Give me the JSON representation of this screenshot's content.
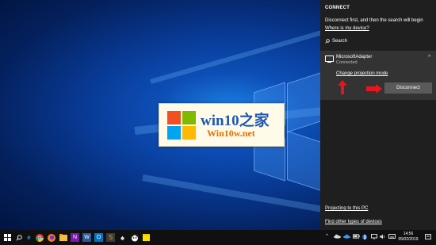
{
  "watermark": {
    "text_main": "win10之家",
    "text_url": "Win10w.net"
  },
  "connect_panel": {
    "title": "CONNECT",
    "description": "Disconnect first, and then the search will begin",
    "where_link": "Where is my device?",
    "search_label": "Search",
    "device": {
      "name": "MicrosoftAdapter",
      "status": "Connected",
      "change_mode_link": "Change projection mode",
      "disconnect_label": "Disconnect"
    },
    "projecting_link": "Projecting to this PC",
    "other_devices_link": "Find other types of devices"
  },
  "taskbar": {
    "time": "14:56",
    "date": "05/02/2019",
    "pinned_icons": [
      "edge-icon",
      "chrome-icon",
      "firefox-icon",
      "file-explorer-icon",
      "onenote-icon",
      "word-icon",
      "outlook-icon",
      "sublime-icon",
      "solitaire-icon",
      "panda-icon",
      "sticky-notes-icon"
    ]
  },
  "colors": {
    "panel_bg": "#1f1f1f",
    "device_bg": "#333333",
    "button_bg": "#5a5a5a",
    "arrow_red": "#e8141e"
  }
}
